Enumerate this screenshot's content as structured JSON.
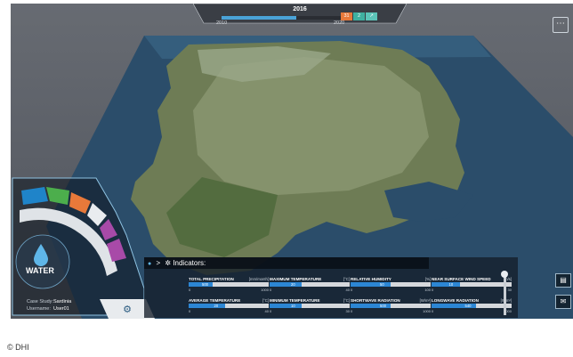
{
  "timeline": {
    "year": "2016",
    "start": "2010",
    "end": "2020",
    "progress": 0.6,
    "buttons": [
      {
        "label": "31",
        "color": "#e8793a"
      },
      {
        "label": "2",
        "color": "#3fb0a0"
      },
      {
        "label": "↗",
        "color": "#5cc4b8"
      }
    ]
  },
  "menu_icon": "more-dots-icon",
  "sector": {
    "name": "WATER",
    "tabs": [
      "water-drop-icon",
      "chat-icon",
      "fire-icon",
      "lightning-icon",
      "mountain-icon",
      "filter-icon"
    ]
  },
  "case_study": {
    "label": "Case Study:",
    "value": "Sardinia"
  },
  "username": {
    "label": "Username:",
    "value": "User01"
  },
  "panel": {
    "title": "Indicators:",
    "breadcrumb_sep": ">"
  },
  "indicators": [
    {
      "label": "TOTAL PRECIPITATION",
      "unit": "[mm/month]",
      "value": "500",
      "fraction": 0.3,
      "min": "0",
      "max": "1000"
    },
    {
      "label": "MAXIMUM TEMPERATURE",
      "unit": "[°C]",
      "value": "20",
      "fraction": 0.4,
      "min": "0",
      "max": "40"
    },
    {
      "label": "RELATIVE HUMIDITY",
      "unit": "[%]",
      "value": "50",
      "fraction": 0.5,
      "min": "0",
      "max": "100"
    },
    {
      "label": "NEAR SURFACE WIND SPEED",
      "unit": "[m/s]",
      "value": "10",
      "fraction": 0.35,
      "min": "0",
      "max": "30"
    },
    {
      "label": "AVERAGE TEMPERATURE",
      "unit": "[°C]",
      "value": "20",
      "fraction": 0.45,
      "min": "0",
      "max": "40"
    },
    {
      "label": "MINIMUM TEMPERATURE",
      "unit": "[°C]",
      "value": "10",
      "fraction": 0.4,
      "min": "0",
      "max": "30"
    },
    {
      "label": "SHORTWAVE RADIATION",
      "unit": "[W/m²]",
      "value": "500",
      "fraction": 0.5,
      "min": "0",
      "max": "1000"
    },
    {
      "label": "LONGWAVE RADIATION",
      "unit": "[W/m²]",
      "value": "540",
      "fraction": 0.55,
      "min": "0",
      "max": "1000"
    }
  ],
  "credit": "© DHI"
}
